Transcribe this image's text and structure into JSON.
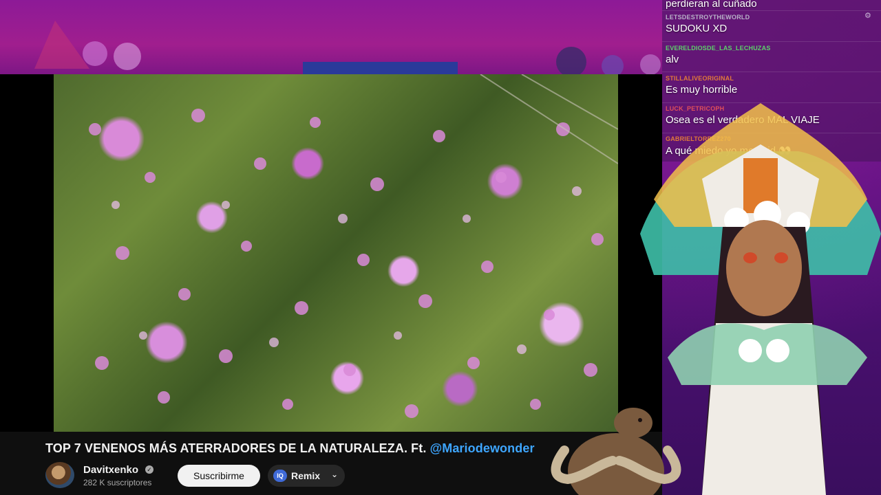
{
  "video": {
    "title_main": "TOP 7 VENENOS MÁS ATERRADORES DE LA NATURALEZA. Ft. ",
    "title_mention": "@Mariodewonder"
  },
  "channel": {
    "name": "Davitxenko",
    "subscribers": "282 K suscriptores"
  },
  "actions": {
    "subscribe_label": "Suscribirme",
    "remix_label": "Remix"
  },
  "chat": {
    "messages": [
      {
        "user": "",
        "text": "perdieran al cuñado",
        "user_color": "#ffffff"
      },
      {
        "user": "LETSDESTROYTHEWORLD",
        "text": "SUDOKU XD",
        "user_color": "#b9b3c9"
      },
      {
        "user": "EVERELDIOSDE_LAS_LECHUZAS",
        "text": "alv",
        "user_color": "#5cd16a"
      },
      {
        "user": "STILLALIVEORIGINAL",
        "text": "Es muy horrible",
        "user_color": "#e07a3a"
      },
      {
        "user": "LUCK_PETRICOPH",
        "text": "Osea es el verdadero MAL VIAJE",
        "user_color": "#e0505a"
      },
      {
        "user": "GABRIELTORREZ270",
        "text": "A qué miedo yo me void 👀",
        "user_color": "#e07a3a"
      }
    ]
  },
  "colors": {
    "accent_mention": "#3ea6ff",
    "bar_bg": "#0f0f0f"
  }
}
